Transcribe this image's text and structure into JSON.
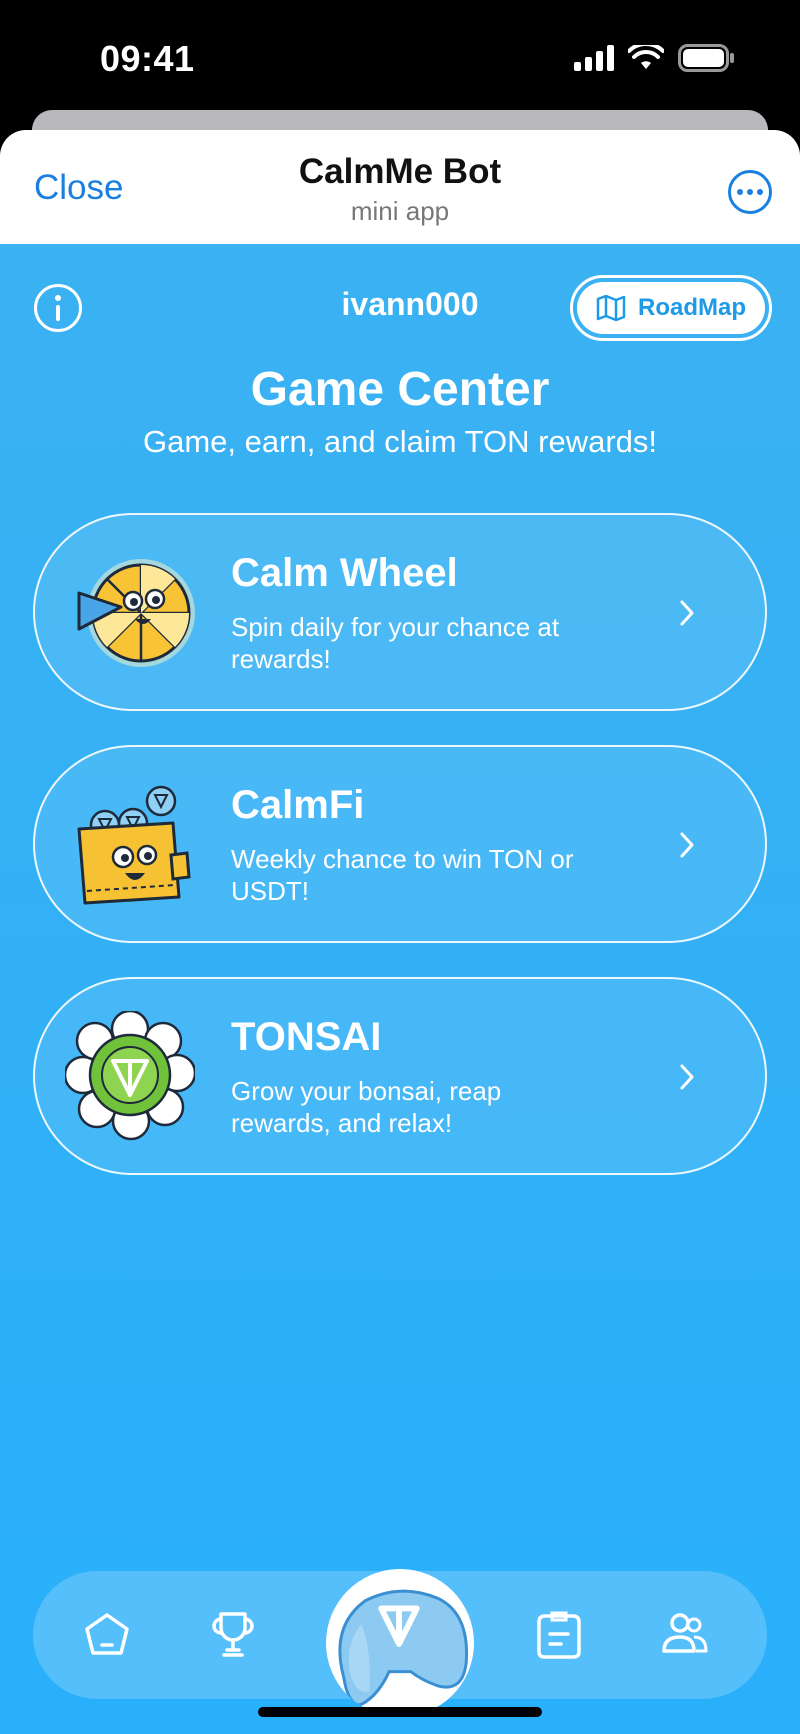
{
  "status_bar": {
    "time": "09:41"
  },
  "header": {
    "close_label": "Close",
    "title": "CalmMe Bot",
    "subtitle": "mini app"
  },
  "top_bar": {
    "username": "ivann000",
    "roadmap_label": "RoadMap"
  },
  "page": {
    "title": "Game Center",
    "subtitle": "Game, earn, and claim TON rewards!"
  },
  "games": [
    {
      "title": "Calm Wheel",
      "description": "Spin daily for your chance at rewards!"
    },
    {
      "title": "CalmFi",
      "description": "Weekly chance to win TON or USDT!"
    },
    {
      "title": "TONSAI",
      "description": "Grow your bonsai, reap rewards, and relax!"
    }
  ],
  "nav": {
    "items": [
      "home-icon",
      "trophy-icon",
      "gamepad-icon",
      "tasks-icon",
      "friends-icon"
    ],
    "active": "gamepad-icon"
  },
  "colors": {
    "background": "#2fb1f8",
    "accent": "#1b7fe0",
    "white": "#ffffff"
  }
}
